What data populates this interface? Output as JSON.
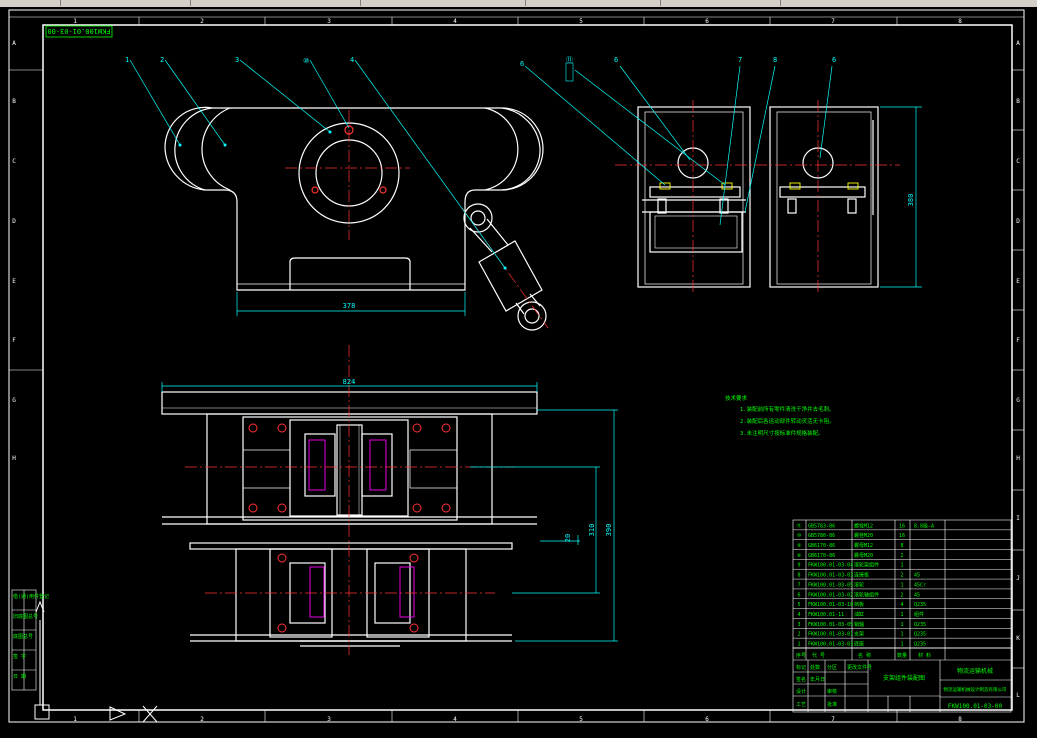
{
  "drawing": {
    "number_tag": "FKW100.01-03-00",
    "number_bottom": "FKW100.01-03-00",
    "title_block_name": "支架组件装配图",
    "company": "物流运输机械",
    "company_sub": "物流运输机械设计制造有限公司"
  },
  "border": {
    "col_numbers": [
      "1",
      "2",
      "3",
      "4",
      "5",
      "6",
      "7",
      "8"
    ],
    "row_letters": [
      "A",
      "B",
      "C",
      "D",
      "E",
      "F",
      "G",
      "H",
      "I",
      "J",
      "K",
      "L"
    ]
  },
  "dimensions": {
    "front_width": "378",
    "side_height": "380",
    "plan_width": "824",
    "plan_small": "20",
    "plan_mid": "310",
    "plan_height": "390"
  },
  "balloons": {
    "front": [
      "1",
      "2",
      "3",
      "⑩",
      "4"
    ],
    "side": [
      "6",
      "⑪",
      "6",
      "7",
      "8",
      "6"
    ]
  },
  "notes": {
    "heading": "技术要求",
    "lines": [
      "1.装配前所有零件清洗干净并去毛刺。",
      "2.装配后各运动部件转动灵活无卡阻。",
      "3.未注明尺寸按标准件规格装配。"
    ]
  },
  "bom": {
    "rows": [
      {
        "no": "⑪",
        "code": "GB5783-86",
        "name": "螺栓M12",
        "qty": "16",
        "mat": "8.8级-A"
      },
      {
        "no": "⑩",
        "code": "GB5780-86",
        "name": "螺栓M20",
        "qty": "16",
        "mat": ""
      },
      {
        "no": "⑨",
        "code": "GB6170-86",
        "name": "螺母M12",
        "qty": "8",
        "mat": ""
      },
      {
        "no": "⑧",
        "code": "GB6170-86",
        "name": "螺母M20",
        "qty": "2",
        "mat": ""
      },
      {
        "no": "9",
        "code": "FKW100.01-03-04",
        "name": "滚轮架组件",
        "qty": "1",
        "mat": ""
      },
      {
        "no": "8",
        "code": "FKW100.01-03-03",
        "name": "连接板",
        "qty": "2",
        "mat": "45"
      },
      {
        "no": "7",
        "code": "FKW100.01-03-05",
        "name": "滚轮",
        "qty": "1",
        "mat": "45Cr"
      },
      {
        "no": "6",
        "code": "FKW100.01-03-02",
        "name": "滚轮轴组件",
        "qty": "2",
        "mat": "45"
      },
      {
        "no": "5",
        "code": "FKW100.01-03-10",
        "name": "挡板",
        "qty": "4",
        "mat": "Q235"
      },
      {
        "no": "4",
        "code": "FKW100.01-11",
        "name": "油缸",
        "qty": "1",
        "mat": "组件"
      },
      {
        "no": "3",
        "code": "FKW100.01-03-05",
        "name": "销轴",
        "qty": "1",
        "mat": "Q235"
      },
      {
        "no": "2",
        "code": "FKW100.01-03-01",
        "name": "支架",
        "qty": "1",
        "mat": "Q235"
      },
      {
        "no": "1",
        "code": "FKW100.01-03-03",
        "name": "底座",
        "qty": "1",
        "mat": "Q235"
      }
    ],
    "header": {
      "no": "序号",
      "code": "代 号",
      "name": "名 称",
      "qty": "数量",
      "mat": "材 料"
    },
    "small_labels": [
      "标记",
      "处数",
      "分区",
      "更改文件号",
      "签名",
      "年月日",
      "设计",
      "审核",
      "工艺",
      "批准"
    ]
  },
  "left_strip": {
    "labels": [
      "借(通)用件登记",
      "旧底图总号",
      "底图总号",
      "签 字",
      "日 期"
    ]
  }
}
